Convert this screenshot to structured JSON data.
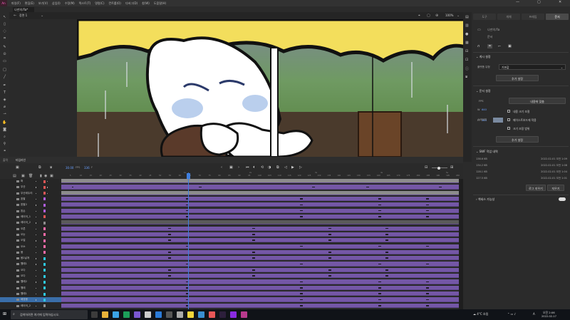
{
  "app": {
    "logo": "An",
    "menus": [
      "파일(F)",
      "편집(E)",
      "보기(V)",
      "삽입(I)",
      "수정(M)",
      "텍스트(T)",
      "명령(C)",
      "컨트롤(O)",
      "디버그(D)",
      "창(W)",
      "도움말(H)"
    ],
    "window_controls": [
      "—",
      "▢",
      "✕"
    ],
    "accent": "#ff61c4"
  },
  "document": {
    "tab": "나만의.fla*",
    "scene": "장면 1",
    "zoom": "100%"
  },
  "timeline": {
    "tabs": [
      "출력",
      "타임라인"
    ],
    "fps": "30.00",
    "frame": "336",
    "ruler": [
      "",
      "5",
      "10",
      "15",
      "20",
      "25",
      "30",
      "35",
      "40",
      "45",
      "50",
      "55",
      "60",
      "65",
      "70",
      "75",
      "80",
      "85",
      "90",
      "95",
      "100",
      "105",
      "110",
      "115",
      "120",
      "125",
      "130",
      "135",
      "140",
      "145",
      "150",
      "155",
      "160",
      "165",
      "170",
      "175",
      "180",
      "185",
      "190",
      "195",
      "200"
    ],
    "ruler_top": [
      "",
      "1s",
      "2s",
      "3s",
      "4s",
      "5s",
      "6s"
    ],
    "layers": [
      {
        "name": "퍼",
        "color": "#e05656"
      },
      {
        "name": "우산",
        "color": "#e05656"
      },
      {
        "name": "우산테두리",
        "color": "#e05656"
      },
      {
        "name": "왼팔",
        "color": "#b05ee0"
      },
      {
        "name": "왼팔2",
        "color": "#b05ee0"
      },
      {
        "name": "왼손",
        "color": "#b05ee0"
      },
      {
        "name": "레이어_1",
        "color": "#e05656"
      },
      {
        "name": "레이어_2",
        "color": "#8d8d8d"
      },
      {
        "name": "오른",
        "color": "#ff6aa8"
      },
      {
        "name": "오눈",
        "color": "#ff6aa8"
      },
      {
        "name": "오얼",
        "color": "#ff6aa8"
      },
      {
        "name": "오소",
        "color": "#ff6aa8"
      },
      {
        "name": "몸",
        "color": "#ff6aa8"
      },
      {
        "name": "몸2날개",
        "color": "#2ec8e0"
      },
      {
        "name": "웹레1",
        "color": "#2ec8e0"
      },
      {
        "name": "오다",
        "color": "#2ec8e0"
      },
      {
        "name": "오다",
        "color": "#2ec8e0"
      },
      {
        "name": "웹레2",
        "color": "#2ec8e0"
      },
      {
        "name": "웹레",
        "color": "#2ec8e0"
      },
      {
        "name": "웹레1",
        "color": "#2ec8e0"
      },
      {
        "name": "배경몸",
        "color": "#2ec8e0"
      },
      {
        "name": "레이어_2",
        "color": "#8d8d8d"
      }
    ]
  },
  "right_panel": {
    "tabs": [
      "도구",
      "개체",
      "프레임",
      "문서"
    ],
    "active_tab": "문서",
    "doc_name": "나만의.fla",
    "doc_label": "문서",
    "section_publish": "게시 설정",
    "publish_label": "플랫폼 유형",
    "publish_value": "기본값",
    "btn_more1": "추가 설정",
    "section_doc": "문서 설정",
    "fps_label": "FPS",
    "stage_size_btn": "내용에 맞춤",
    "w_label": "W",
    "w_value": "640",
    "h_label": "H",
    "h_value": "360",
    "opt1": "내용 크기 조절",
    "opt2": "페이스트보드에 적용",
    "opt3": "크기 조정 범위",
    "stage_label": "스테이지",
    "stage_color": "#7a8aa0",
    "btn_more2": "추가 설정",
    "section_history": "SWF 작업 내역",
    "history": [
      {
        "size": "138.6 KB",
        "date": "2022-02-01 오전 1:09"
      },
      {
        "size": "134.2 KB",
        "date": "2022-02-01 오전 1:08"
      },
      {
        "size": "128.1 KB",
        "date": "2022-02-01 오전 1:04"
      },
      {
        "size": "127.5 KB",
        "date": "2022-02-01 오전 1:01"
      }
    ],
    "btn_log": "로그 지우기",
    "btn_clear": "지우기",
    "section_access": "액세스 가능성"
  },
  "taskbar": {
    "search_placeholder": "검색하려면 여기에 입력하십시오.",
    "weather": "4°C 흐림",
    "time": "오전 2:06",
    "date": "2022-02-17",
    "lang": "A"
  }
}
